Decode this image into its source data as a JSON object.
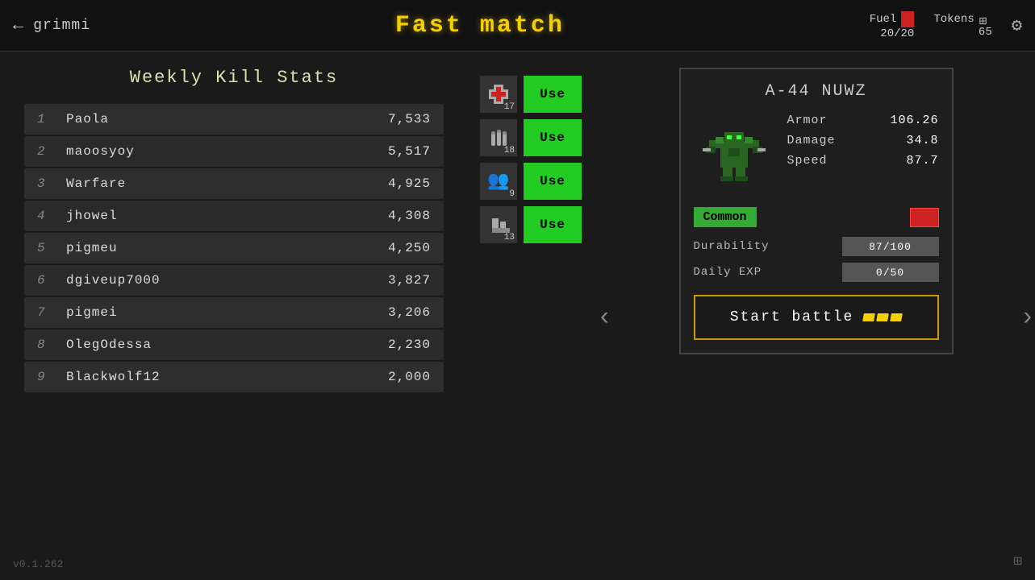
{
  "header": {
    "back_label": "←",
    "username": "grimmi",
    "title": "Fast match",
    "fuel_label": "Fuel",
    "fuel_value": "20/20",
    "tokens_label": "Tokens",
    "tokens_value": "65"
  },
  "leaderboard": {
    "title": "Weekly Kill Stats",
    "rows": [
      {
        "rank": "1",
        "name": "Paola",
        "score": "7,533"
      },
      {
        "rank": "2",
        "name": "maoosyoy",
        "score": "5,517"
      },
      {
        "rank": "3",
        "name": "Warfare",
        "score": "4,925"
      },
      {
        "rank": "4",
        "name": "jhowel",
        "score": "4,308"
      },
      {
        "rank": "5",
        "name": "pigmeu",
        "score": "4,250"
      },
      {
        "rank": "6",
        "name": "dgiveup7000",
        "score": "3,827"
      },
      {
        "rank": "7",
        "name": "pigmei",
        "score": "3,206"
      },
      {
        "rank": "8",
        "name": "OlegOdessa",
        "score": "2,230"
      },
      {
        "rank": "9",
        "name": "Blackwolf12",
        "score": "2,000"
      }
    ]
  },
  "inventory": {
    "items": [
      {
        "count": "17",
        "label": "medical-kit",
        "use_label": "Use"
      },
      {
        "count": "18",
        "label": "ammo",
        "use_label": "Use"
      },
      {
        "count": "9",
        "label": "team",
        "use_label": "Use"
      },
      {
        "count": "13",
        "label": "boots",
        "use_label": "Use"
      }
    ]
  },
  "weapon": {
    "name": "A-44 NUWZ",
    "armor": "106.26",
    "damage": "34.8",
    "speed": "87.7",
    "rarity": "Common",
    "durability_label": "Durability",
    "durability_value": "87/100",
    "daily_exp_label": "Daily EXP",
    "daily_exp_value": "0/50",
    "start_battle_label": "Start battle"
  },
  "footer": {
    "version": "v0.1.262"
  }
}
